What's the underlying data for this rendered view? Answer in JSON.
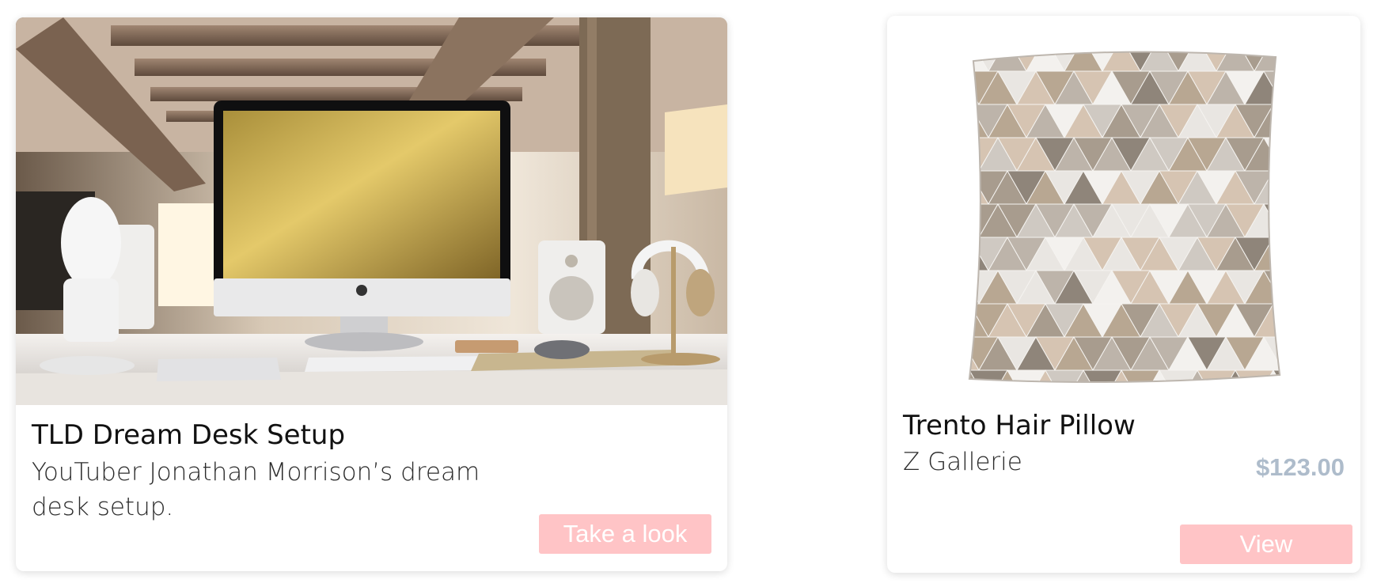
{
  "cards": [
    {
      "title": "TLD Dream Desk Setup",
      "description": "YouTuber Jonathan Morrison’s dream desk setup.",
      "button_label": "Take a look"
    },
    {
      "title": "Trento Hair Pillow",
      "subtitle": "Z Gallerie",
      "price": "$123.00",
      "button_label": "View"
    }
  ],
  "colors": {
    "button_background": "#ffc4c6",
    "price": "#aebccb",
    "title": "#111111"
  }
}
